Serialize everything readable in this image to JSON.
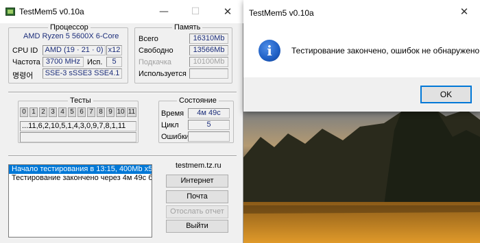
{
  "main_window": {
    "title": "TestMem5 v0.10a",
    "controls": {
      "minimize": "—",
      "maximize": "☐",
      "close": "✕"
    },
    "processor": {
      "title": "Процессор",
      "cpu_name": "AMD Ryzen 5 5600X 6-Core",
      "cpu_id_label": "CPU ID",
      "cpu_id_value": "AMD  (19 · 21 · 0)",
      "cpu_id_extra": "x12",
      "freq_label": "Частота",
      "freq_value": "3700 MHz",
      "used_label": "Исп.",
      "used_value": "5",
      "ext_label": "명령어",
      "ext_value": "SSE-3 sSSE3 SSE4.1"
    },
    "memory": {
      "title": "Память",
      "total_label": "Всего",
      "total_value": "16310Mb",
      "free_label": "Свободно",
      "free_value": "13566Mb",
      "swap_label": "Подкачка",
      "swap_value": "10100Mb",
      "used_label": "Используется",
      "used_value": ""
    },
    "tests": {
      "title": "Тесты",
      "numbers": [
        "0",
        "1",
        "2",
        "3",
        "4",
        "5",
        "6",
        "7",
        "8",
        "9",
        "10",
        "11"
      ],
      "sequence": "...11,6,2,10,5,1,4,3,0,9,7,8,1,11"
    },
    "state": {
      "title": "Состояние",
      "time_label": "Время",
      "time_value": "4м 49с",
      "cycle_label": "Цикл",
      "cycle_value": "5",
      "errors_label": "Ошибки",
      "errors_value": ""
    },
    "log": [
      "Начало тестирования в 13:15, 400Mb x5",
      "Тестирование закончено через 4м 49с б"
    ],
    "site": "testmem.tz.ru",
    "buttons": {
      "internet": "Интернет",
      "mail": "Почта",
      "send_report": "Отослать отчет",
      "exit": "Выйти"
    }
  },
  "dialog": {
    "title": "TestMem5 v0.10a",
    "close": "✕",
    "icon": "info-icon",
    "icon_glyph": "i",
    "message": "Тестирование закончено, ошибок не обнаружено.",
    "ok_label": "OK"
  },
  "colors": {
    "accent": "#0078d7",
    "value_text": "#1b2d7a"
  }
}
